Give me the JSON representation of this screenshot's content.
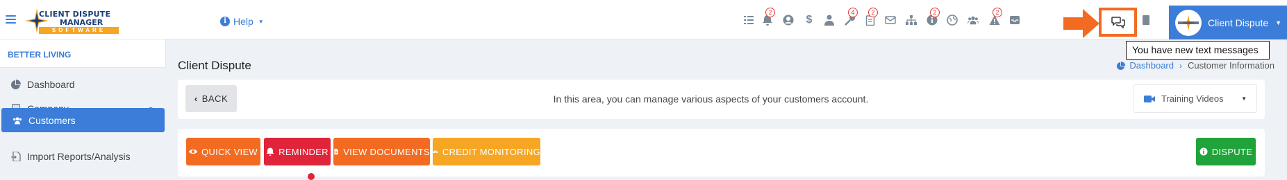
{
  "colors": {
    "primary": "#3b7dd8",
    "orange": "#f36b21",
    "red": "#e0243a",
    "amber": "#f6a623",
    "green": "#1fa33a",
    "highlight": "#f36b21"
  },
  "header": {
    "logo": {
      "line1": "CLIENT DISPUTE",
      "line2": "MANAGER",
      "line3": "SOFTWARE"
    },
    "help_label": "Help",
    "icons": [
      {
        "name": "tasks-icon",
        "badge": ""
      },
      {
        "name": "bell-icon",
        "badge": "2"
      },
      {
        "name": "user-circle-icon",
        "badge": ""
      },
      {
        "name": "dollar-icon",
        "badge": ""
      },
      {
        "name": "user-tie-icon",
        "badge": ""
      },
      {
        "name": "key-icon",
        "badge": "4"
      },
      {
        "name": "clipboard-icon",
        "badge": "2"
      },
      {
        "name": "envelope-icon",
        "badge": ""
      },
      {
        "name": "sitemap-icon",
        "badge": ""
      },
      {
        "name": "info-circle-icon",
        "badge": "2"
      },
      {
        "name": "globe-icon",
        "badge": ""
      },
      {
        "name": "users-icon",
        "badge": ""
      },
      {
        "name": "warning-icon",
        "badge": "2"
      },
      {
        "name": "inbox-icon",
        "badge": ""
      }
    ],
    "messages_icon": "comments-icon",
    "tooltip": "You have new text messages",
    "user_name": "Client Dispute"
  },
  "sidebar": {
    "brand": "BETTER LIVING",
    "items": [
      {
        "label": "Dashboard",
        "icon": "chart-pie-icon",
        "active": false
      },
      {
        "label": "Company",
        "icon": "building-icon",
        "active": false,
        "dropdown": true
      },
      {
        "label": "Customers",
        "icon": "users-icon",
        "active": true
      },
      {
        "label": "Import Reports/Analysis",
        "icon": "file-import-icon",
        "active": false
      }
    ]
  },
  "main": {
    "title": "Client Dispute",
    "breadcrumb": {
      "home": "Dashboard",
      "current": "Customer Information"
    },
    "info_bar": {
      "back_label": "BACK",
      "message": "In this area, you can manage various aspects of your customers account.",
      "training_label": "Training Videos"
    },
    "actions": {
      "quick_view": "QUICK VIEW",
      "reminder": "REMINDER",
      "view_documents": "VIEW DOCUMENTS",
      "credit_monitoring": "CREDIT MONITORING",
      "dispute": "DISPUTE"
    }
  }
}
